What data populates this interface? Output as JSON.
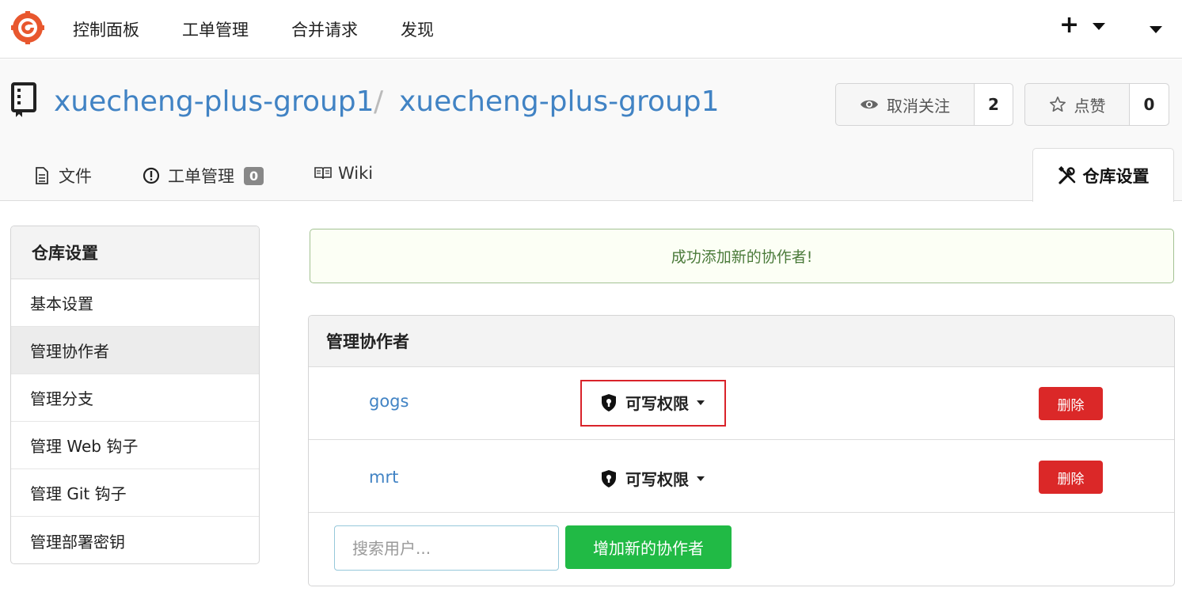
{
  "nav": {
    "items": [
      "控制面板",
      "工单管理",
      "合并请求",
      "发现"
    ],
    "logo_icon": "gogs-logo-icon",
    "plus_icon": "plus-icon",
    "brand_color": "#e8572e"
  },
  "repo": {
    "owner": "xuecheng-plus-group1",
    "separator": "/",
    "name": "xuecheng-plus-group1",
    "watch_label": "取消关注",
    "watch_count": "2",
    "star_label": "点赞",
    "star_count": "0"
  },
  "tabs": {
    "files": "文件",
    "issues": "工单管理",
    "issues_count": "0",
    "wiki": "Wiki",
    "settings": "仓库设置"
  },
  "sidebar": {
    "title": "仓库设置",
    "items": [
      "基本设置",
      "管理协作者",
      "管理分支",
      "管理 Web 钩子",
      "管理 Git 钩子",
      "管理部署密钥"
    ],
    "active_index": 1
  },
  "flash": {
    "message": "成功添加新的协作者!"
  },
  "collaborators": {
    "title": "管理协作者",
    "rows": [
      {
        "user": "gogs",
        "permission": "可写权限",
        "delete_label": "删除"
      },
      {
        "user": "mrt",
        "permission": "可写权限",
        "delete_label": "删除"
      }
    ],
    "search_placeholder": "搜索用户...",
    "add_label": "增加新的协作者"
  },
  "colors": {
    "link": "#4183c4",
    "danger": "#db2828",
    "success": "#21ba45",
    "highlight": "#d9232a"
  }
}
